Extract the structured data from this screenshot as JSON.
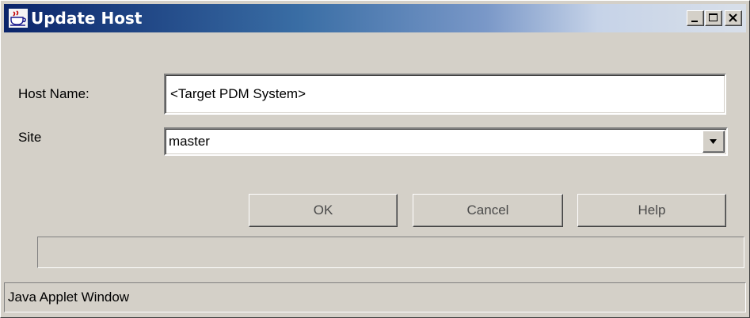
{
  "window": {
    "title": "Update Host",
    "icon": "java-cup-icon",
    "controls": [
      "minimize",
      "maximize",
      "close"
    ]
  },
  "form": {
    "host_name_label": "Host Name:",
    "host_name_value": "<Target PDM System>",
    "site_label": "Site",
    "site_value": "master"
  },
  "buttons": {
    "ok": "OK",
    "cancel": "Cancel",
    "help": "Help"
  },
  "status_bar": {
    "text": "Java Applet Window"
  }
}
